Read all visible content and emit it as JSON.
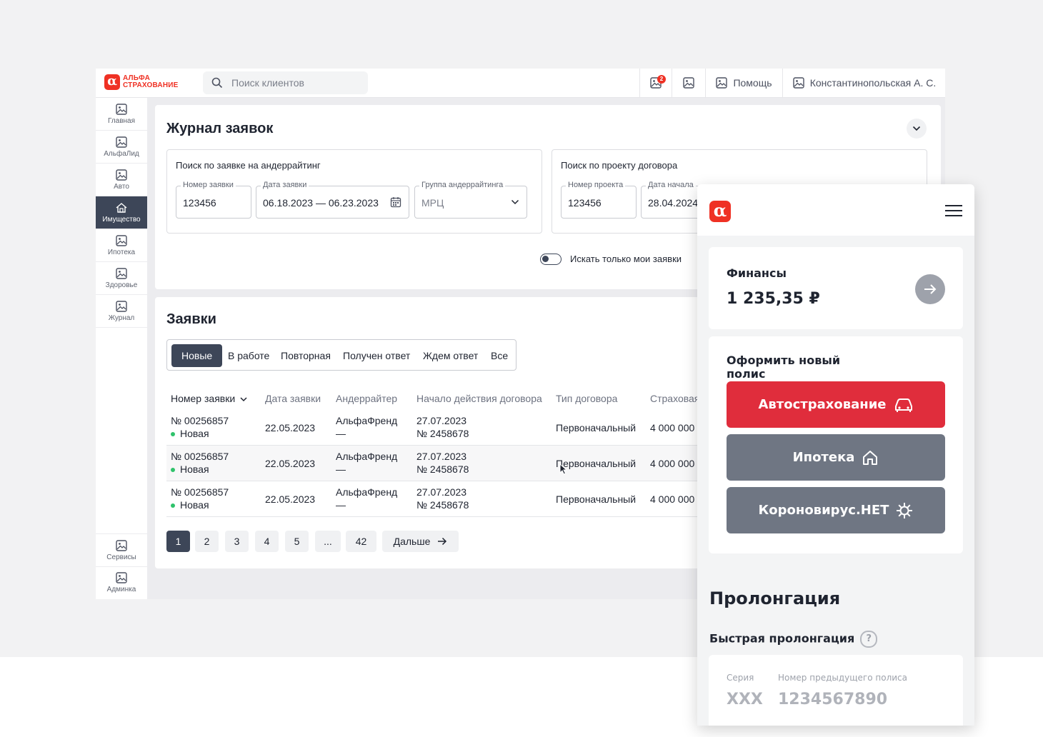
{
  "app": {
    "logo_line1": "АЛЬФА",
    "logo_line2": "СТРАХОВАНИЕ",
    "logo_mark": "α",
    "search_placeholder": "Поиск клиентов",
    "notifications_count": "2",
    "help_label": "Помощь",
    "user_name": "Константинопольская А. С."
  },
  "sidebar": {
    "items": [
      {
        "label": "Главная",
        "icon": "image-icon"
      },
      {
        "label": "АльфаЛид",
        "icon": "image-icon"
      },
      {
        "label": "Авто",
        "icon": "image-icon"
      },
      {
        "label": "Имущество",
        "icon": "house-icon",
        "active": true
      },
      {
        "label": "Ипотека",
        "icon": "image-icon"
      },
      {
        "label": "Здоровье",
        "icon": "image-icon"
      },
      {
        "label": "Журнал",
        "icon": "image-icon"
      }
    ],
    "bottom_items": [
      {
        "label": "Сервисы",
        "icon": "image-icon"
      },
      {
        "label": "Админка",
        "icon": "image-icon"
      }
    ]
  },
  "journal": {
    "title": "Журнал заявок",
    "underwriting_search": {
      "title": "Поиск по заявке на андеррайтинг",
      "request_number_label": "Номер заявки",
      "request_number_value": "123456",
      "request_date_label": "Дата заявки",
      "request_date_value": "06.18.2023 — 06.23.2023",
      "group_label": "Группа андеррайтинга",
      "group_value": "МРЦ"
    },
    "contract_search": {
      "title": "Поиск по проекту договора",
      "project_number_label": "Номер проекта",
      "project_number_value": "123456",
      "start_date_label": "Дата начала",
      "start_date_value": "28.04.2024"
    },
    "only_mine_label": "Искать только мои заявки"
  },
  "requests": {
    "title": "Заявки",
    "tabs": [
      "Новые",
      "В работе",
      "Повторная",
      "Получен ответ",
      "Ждем ответ",
      "Все"
    ],
    "columns": [
      "Номер заявки",
      "Дата заявки",
      "Андеррайтер",
      "Начало действия договора",
      "Тип договора",
      "Страховая"
    ],
    "rows": [
      {
        "number": "№ 00256857",
        "status": "Новая",
        "date": "22.05.2023",
        "underwriter": "АльфаФренд",
        "underwriter_sub": "—",
        "start": "27.07.2023",
        "start_sub": "№ 2458678",
        "type": "Первоначальный",
        "sum": "4 000 000"
      },
      {
        "number": "№ 00256857",
        "status": "Новая",
        "date": "22.05.2023",
        "underwriter": "АльфаФренд",
        "underwriter_sub": "—",
        "start": "27.07.2023",
        "start_sub": "№ 2458678",
        "type": "Первоначальный",
        "sum": "4 000 000"
      },
      {
        "number": "№ 00256857",
        "status": "Новая",
        "date": "22.05.2023",
        "underwriter": "АльфаФренд",
        "underwriter_sub": "—",
        "start": "27.07.2023",
        "start_sub": "№ 2458678",
        "type": "Первоначальный",
        "sum": "4 000 000"
      }
    ],
    "pagination": {
      "pages": [
        "1",
        "2",
        "3",
        "4",
        "5",
        "...",
        "42"
      ],
      "current": "1",
      "next_label": "Дальше"
    }
  },
  "mobile": {
    "logo_mark": "α",
    "finance_label": "Финансы",
    "finance_value": "1 235,35 ₽",
    "new_policy_title": "Оформить новый полис",
    "buttons": [
      {
        "label": "Автострахование",
        "icon": "car-icon",
        "color": "#e02d3c"
      },
      {
        "label": "Ипотека",
        "icon": "home-icon",
        "color": "#6f7683"
      },
      {
        "label": "Короновирус.НЕТ",
        "icon": "virus-icon",
        "color": "#6f7683"
      }
    ],
    "prolongation_title": "Пролонгация",
    "fast_prolongation_label": "Быстрая пролонгация",
    "series_label": "Серия",
    "series_placeholder": "XXX",
    "prev_policy_label": "Номер предыдущего полиса",
    "prev_policy_placeholder": "1234567890"
  },
  "colors": {
    "brand_red": "#ef3124",
    "active_dark": "#3d4658",
    "status_green": "#2fc26b"
  }
}
